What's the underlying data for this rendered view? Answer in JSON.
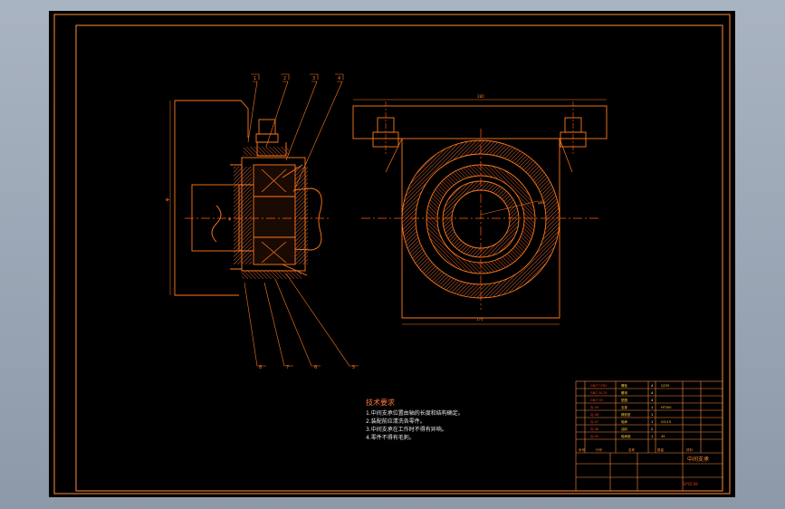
{
  "drawing": {
    "title_block_name": "中间支承",
    "tech_title": "技术要求",
    "tech_lines": [
      "1.中间支承位置由轴的长度和结构确定。",
      "2.装配前应清洗各零件。",
      "3.中间支承在工作时不得有异响。",
      "4.零件不得有毛刺。"
    ],
    "balloons": [
      "1",
      "2",
      "3",
      "4",
      "5",
      "6",
      "7",
      "8"
    ]
  },
  "colors": {
    "frame": "#ff8c3a",
    "line": "#ff7a1a",
    "hatch": "#c8502a",
    "center": "#ff5a1a",
    "text_white": "#ffffff",
    "yellow": "#ffd23a",
    "red": "#ff3b2f"
  }
}
